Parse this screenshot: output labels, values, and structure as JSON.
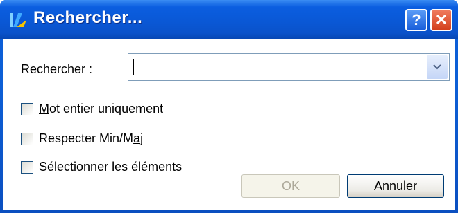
{
  "window": {
    "title": "Rechercher...",
    "help_glyph": "?",
    "close_glyph": "✕",
    "app_icon": "app-logo-icon"
  },
  "search": {
    "label": "Rechercher :",
    "value": "",
    "placeholder": ""
  },
  "options": [
    {
      "label_access": "M",
      "label_rest": "ot entier uniquement",
      "checked": false
    },
    {
      "label_pre": "Respecter Min/M",
      "label_access": "a",
      "label_post": "j",
      "checked": false
    },
    {
      "label_access": "S",
      "label_rest": "électionner les éléments",
      "checked": false
    }
  ],
  "buttons": {
    "ok_label": "OK",
    "ok_enabled": false,
    "cancel_label": "Annuler"
  },
  "colors": {
    "titlebar": "#0a58d6",
    "close": "#d4401c"
  }
}
